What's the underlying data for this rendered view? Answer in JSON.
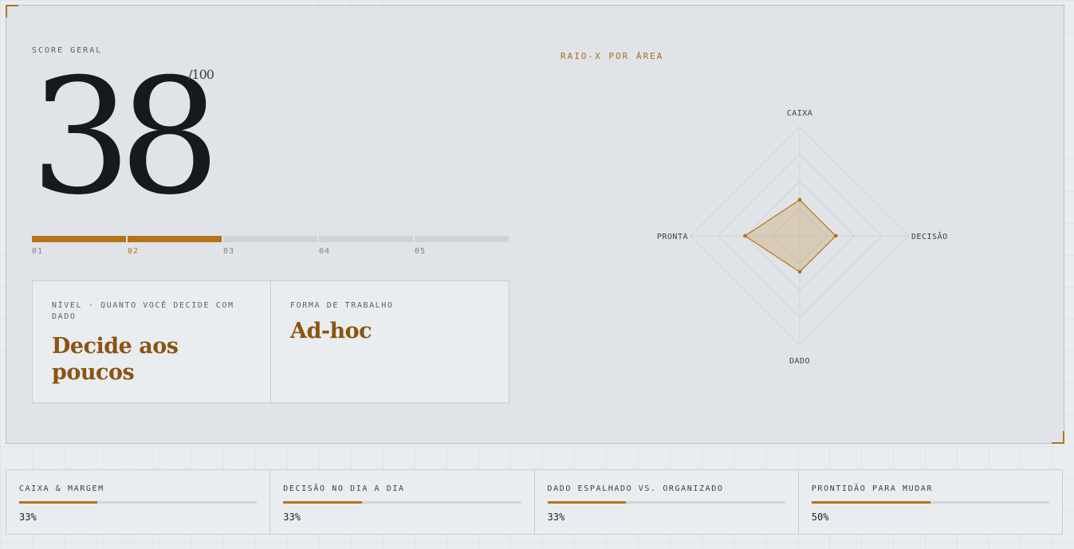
{
  "score": {
    "label": "SCORE GERAL",
    "value": "38",
    "max": "/100"
  },
  "levels": {
    "labels": [
      "01",
      "02",
      "03",
      "04",
      "05"
    ],
    "current": 2
  },
  "nivel": {
    "label": "NÍVEL · QUANTO VOCÊ DECIDE COM DADO",
    "value": "Decide aos poucos"
  },
  "forma": {
    "label": "FORMA DE TRABALHO",
    "value": "Ad-hoc"
  },
  "radar": {
    "title": "RAIO-X POR ÁREA",
    "axes": [
      "CAIXA",
      "DECISÃO",
      "DADO",
      "PRONTA"
    ],
    "values": [
      0.33,
      0.33,
      0.33,
      0.5
    ],
    "rings": 4,
    "colors": {
      "fill": "#c8a062",
      "stroke": "#b5741a",
      "grid": "#cfd3d8"
    }
  },
  "metrics": [
    {
      "label": "CAIXA & MARGEM",
      "value": "33%",
      "fraction": 0.33
    },
    {
      "label": "DECISÃO NO DIA A DIA",
      "value": "33%",
      "fraction": 0.33
    },
    {
      "label": "DADO ESPALHADO VS. ORGANIZADO",
      "value": "33%",
      "fraction": 0.33
    },
    {
      "label": "PRONTIDÃO PARA MUDAR",
      "value": "50%",
      "fraction": 0.5
    }
  ],
  "colors": {
    "accent": "#b5741a",
    "accent_text": "#8a5412",
    "ink": "#161a1d"
  }
}
